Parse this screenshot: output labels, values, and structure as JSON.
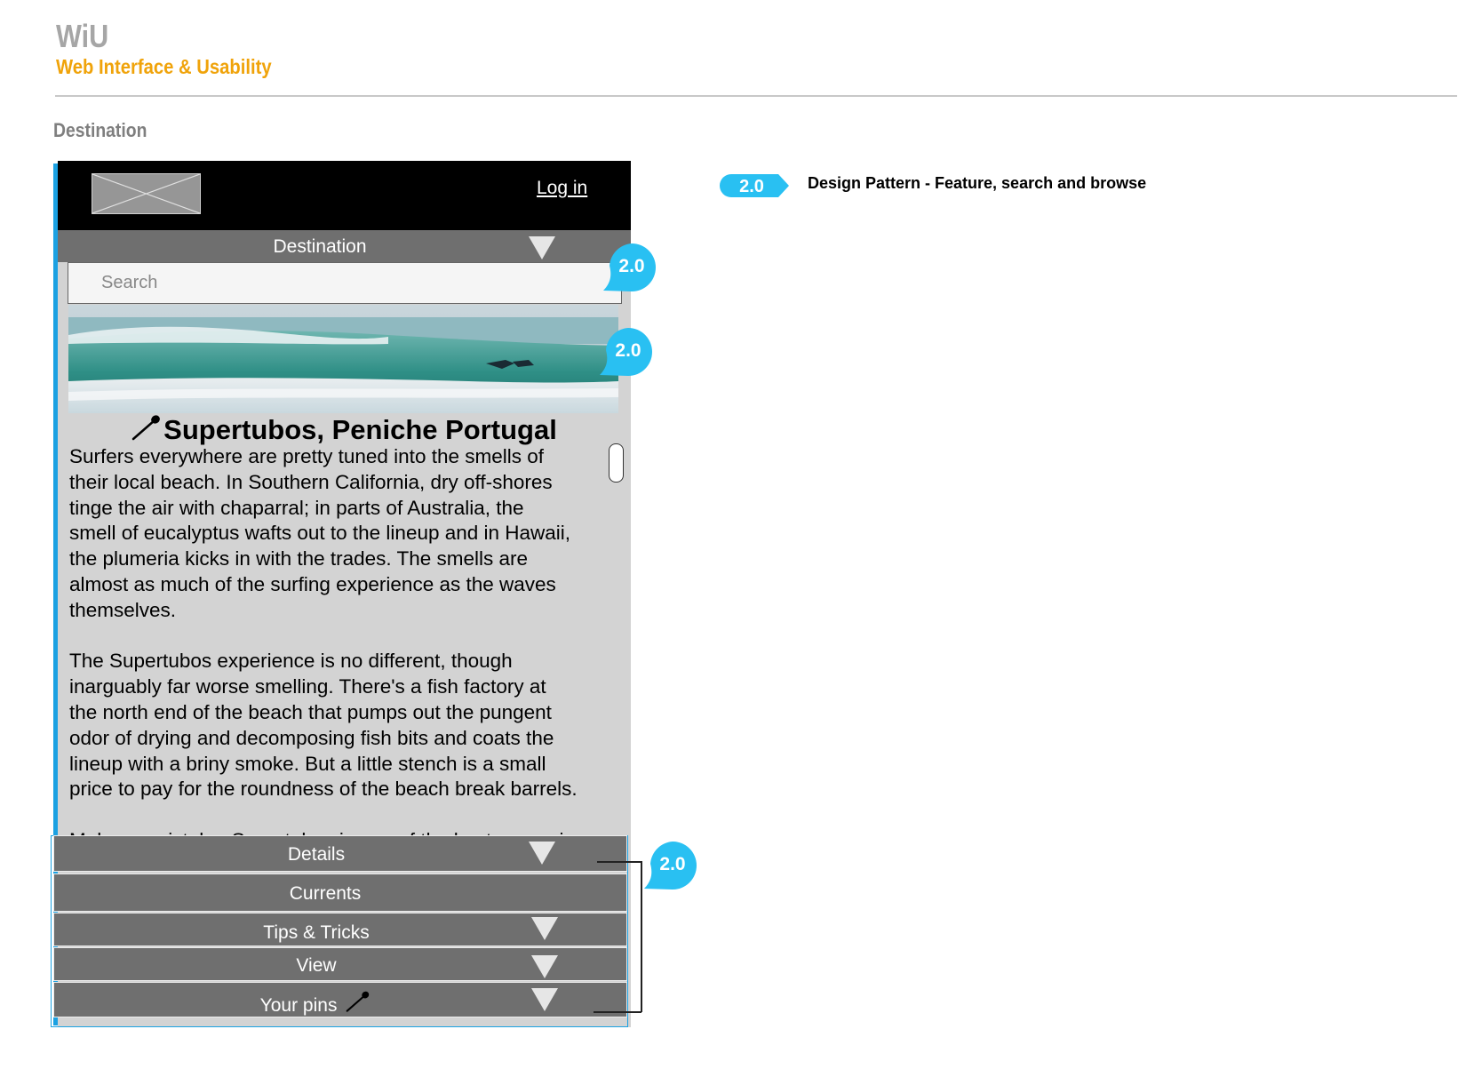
{
  "header": {
    "brand": "WiU",
    "subtitle": "Web Interface & Usability",
    "page_label": "Destination"
  },
  "phone": {
    "login_label": "Log in",
    "destination_menu_label": "Destination",
    "search": {
      "placeholder": "Search",
      "value": ""
    },
    "spot_title": "Supertubos, Peniche Portugal",
    "article": {
      "paragraphs": [
        "Surfers everywhere are pretty tuned into the smells of\ntheir local beach. In Southern California, dry off-shores\ntinge the air with chaparral; in parts of Australia, the\nsmell of eucalyptus wafts out to the lineup and in Hawaii,\n the plumeria kicks in with the trades. The smells are\nalmost as much of the surfing experience as the waves\nthemselves.",
        "The Supertubos experience is no different, though\ninarguably far worse smelling. There's a fish factory at\nthe north end of the beach that pumps out the pungent\n odor of drying and decomposing fish bits and coats the\n lineup with a briny smoke. But a little stench is a small\nprice to pay for the roundness of the beach break barrels.",
        "Make no mistake: Supertubos is one of the best waves in"
      ]
    },
    "accordion": [
      {
        "label": "Details",
        "has_arrow": true
      },
      {
        "label": "Currents",
        "has_arrow": false
      },
      {
        "label": "Tips & Tricks",
        "has_arrow": true
      },
      {
        "label": "View",
        "has_arrow": true
      },
      {
        "label": "Your pins",
        "has_arrow": true
      }
    ]
  },
  "annotations": {
    "search_callout": "2.0",
    "image_callout": "2.0",
    "accordion_callout": "2.0"
  },
  "legend": {
    "tag": "2.0",
    "text": "Design Pattern - Feature, search and browse"
  },
  "colors": {
    "accent_blue": "#1ba1e2",
    "callout_blue": "#29c0f2",
    "brand_orange": "#f0a30a",
    "bar_gray": "#6f6f6f",
    "panel_gray": "#d3d3d3"
  },
  "icons": {
    "logo": "image-placeholder-icon",
    "pin": "map-pin-icon",
    "dropdown": "triangle-down-icon",
    "scroll": "scrollbar-thumb"
  }
}
